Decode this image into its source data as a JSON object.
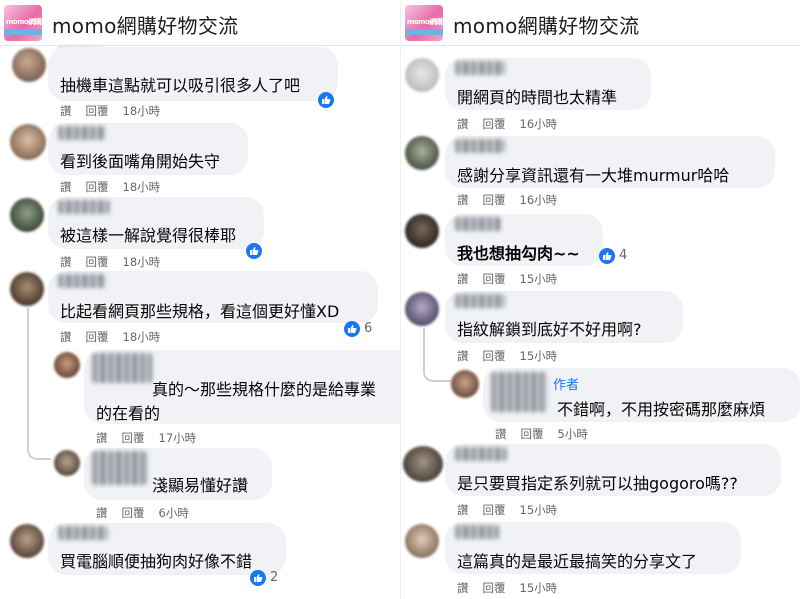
{
  "group": {
    "title": "momo網購好物交流",
    "logo_text": "momo網購好物交流"
  },
  "actions": {
    "read": "讚",
    "reply": "回覆"
  },
  "left": {
    "c1": {
      "text": "抽機車這點就可以吸引很多人了吧",
      "time": "18小時"
    },
    "c2": {
      "text": "看到後面嘴角開始失守",
      "time": "18小時"
    },
    "c3": {
      "text": "被這樣一解說覺得很棒耶",
      "time": "18小時"
    },
    "c4": {
      "text": "比起看網頁那些規格，看這個更好懂XD",
      "time": "18小時",
      "likes": "6"
    },
    "r1": {
      "line1": "真的～那些規格什麼的是給專業",
      "line2": "的在看的",
      "time": "17小時"
    },
    "r2": {
      "text": "淺顯易懂好讚",
      "time": "6小時"
    },
    "c5": {
      "text": "買電腦順便抽狗肉好像不錯",
      "likes": "2"
    }
  },
  "right": {
    "c1": {
      "text": "開網頁的時間也太精準",
      "time": "16小時"
    },
    "c2": {
      "text": "感謝分享資訊還有一大堆murmur哈哈",
      "time": "16小時"
    },
    "c3": {
      "text": "我也想抽勾肉~~",
      "time": "15小時",
      "likes": "4"
    },
    "c4": {
      "text": "指紋解鎖到底好不好用啊?",
      "time": "15小時"
    },
    "r1": {
      "badge": "作者",
      "text": "不錯啊，不用按密碼那麼麻煩",
      "time": "5小時"
    },
    "c5": {
      "text": "是只要買指定系列就可以抽gogoro嗎??",
      "time": "15小時"
    },
    "c6": {
      "text": "這篇真的是最近最搞笑的分享文了",
      "time": "15小時"
    }
  },
  "colors": {
    "like_blue": "#1877f2",
    "bubble_bg": "#f0f2f5",
    "meta_gray": "#65676b"
  },
  "icons": {
    "like": "thumbs-up-icon"
  }
}
